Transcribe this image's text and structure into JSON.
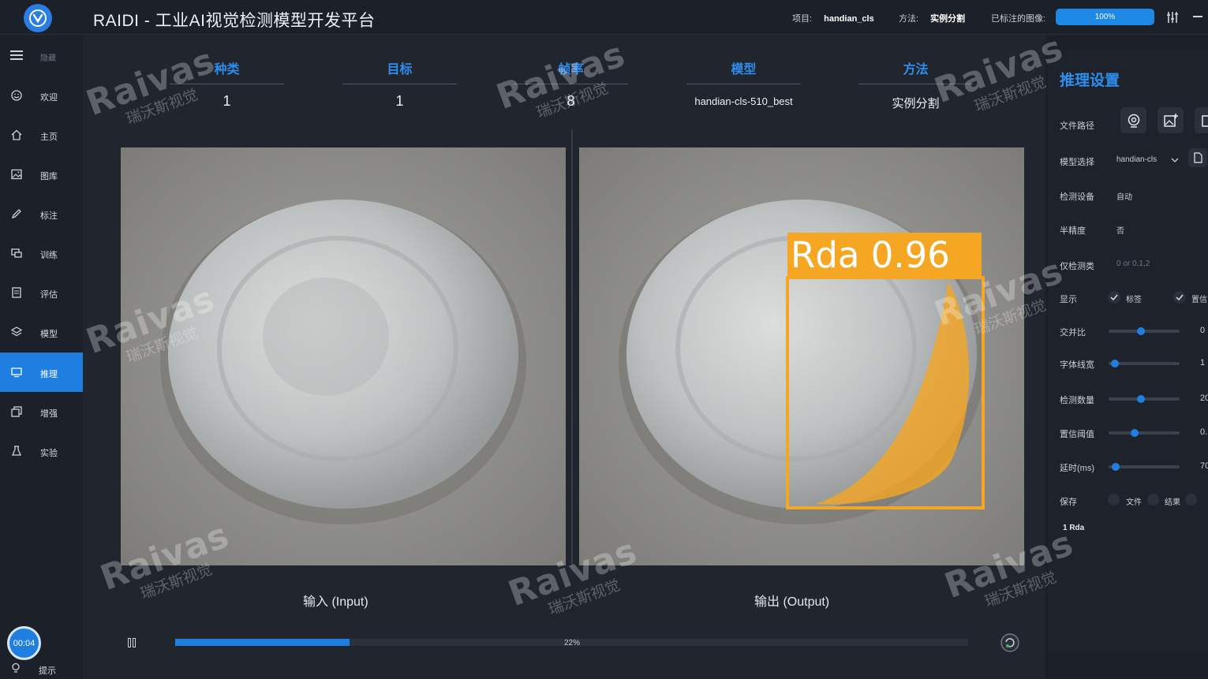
{
  "header": {
    "title": "RAIDI - 工业AI视觉检测模型开发平台",
    "project_label": "项目:",
    "project_value": "handian_cls",
    "method_label": "方法:",
    "method_value": "实例分割",
    "labeled_label": "已标注的图像:",
    "labeled_progress": "100%",
    "labeled_fraction": 1.0
  },
  "sidebar": {
    "hide_label": "隐藏",
    "items": [
      {
        "label": "欢迎",
        "icon": "smile-icon"
      },
      {
        "label": "主页",
        "icon": "home-icon"
      },
      {
        "label": "图库",
        "icon": "image-icon"
      },
      {
        "label": "标注",
        "icon": "pencil-icon"
      },
      {
        "label": "训练",
        "icon": "train-icon"
      },
      {
        "label": "评估",
        "icon": "document-icon"
      },
      {
        "label": "模型",
        "icon": "layers-icon"
      },
      {
        "label": "推理",
        "icon": "monitor-icon",
        "active": true
      },
      {
        "label": "增强",
        "icon": "copy-icon"
      },
      {
        "label": "实验",
        "icon": "flask-icon"
      }
    ],
    "timer": "00:04",
    "tip_label": "提示"
  },
  "stats": [
    {
      "head": "种类",
      "value": "1"
    },
    {
      "head": "目标",
      "value": "1"
    },
    {
      "head": "帧率",
      "value": "8"
    },
    {
      "head": "模型",
      "value": "handian-cls-510_best"
    },
    {
      "head": "方法",
      "value": "实例分割"
    }
  ],
  "panels": {
    "input_caption": "输入 (Input)",
    "output_caption": "输出 (Output)",
    "detection_label": "Rda 0.96"
  },
  "playback": {
    "progress_text": "22%",
    "progress_fraction": 0.22
  },
  "settings": {
    "title": "推理设置",
    "file_path_label": "文件路径",
    "model_select_label": "模型选择",
    "model_select_value": "handian-cls",
    "device_label": "检测设备",
    "device_value": "自动",
    "half_label": "半精度",
    "half_value": "否",
    "classes_label": "仅检测类",
    "classes_placeholder": "0 or 0,1,2",
    "display_label": "显示",
    "display_opt1": "标签",
    "display_opt2": "置信",
    "iou_label": "交并比",
    "iou_value": "0",
    "iou_fraction": 0.45,
    "line_label": "字体线宽",
    "line_value": "1",
    "line_fraction": 0.04,
    "count_label": "检测数量",
    "count_value": "20",
    "count_fraction": 0.45,
    "conf_label": "置信阈值",
    "conf_value": "0.",
    "conf_fraction": 0.35,
    "delay_label": "延时(ms)",
    "delay_value": "70",
    "delay_fraction": 0.05,
    "save_label": "保存",
    "save_opt1": "文件",
    "save_opt2": "结果",
    "result_text": "1 Rda"
  },
  "watermark": {
    "brand": "Raivas",
    "cn": "瑞沃斯视觉"
  },
  "colors": {
    "accent": "#1f7fe0",
    "heading_blue": "#2e8ef0",
    "detection_orange": "#f5a623",
    "bg": "#20252e"
  }
}
